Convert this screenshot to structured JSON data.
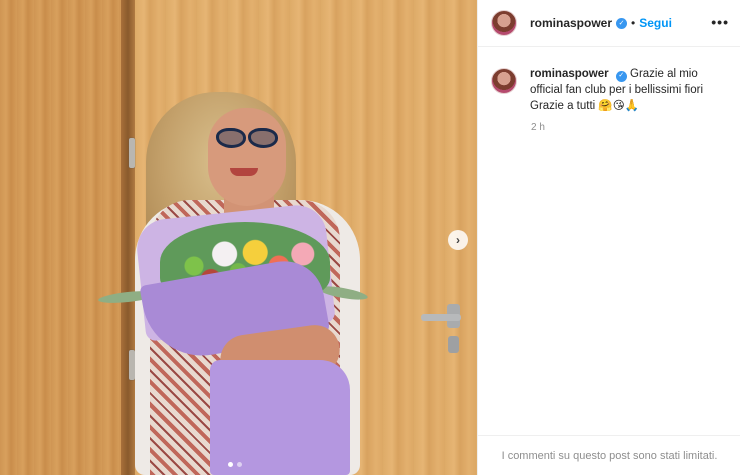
{
  "post": {
    "author": "rominaspower",
    "follow_label": "Segui",
    "separator": "•",
    "more_icon": "more-horizontal-icon",
    "more_glyph": "•••",
    "verified_glyph": "✓",
    "caption_text": "Grazie al mio official fan club per i bellissimi fiori Grazie a tutti 🤗😘🙏",
    "timestamp": "2 h",
    "comments_notice": "I commenti su questo post sono stati limitati."
  },
  "carousel": {
    "next_glyph": "›",
    "slide_count": 2,
    "active_slide": 1
  },
  "colors": {
    "accent": "#0095f6",
    "verified": "#3897f0",
    "muted_text": "#8e8e8e"
  }
}
